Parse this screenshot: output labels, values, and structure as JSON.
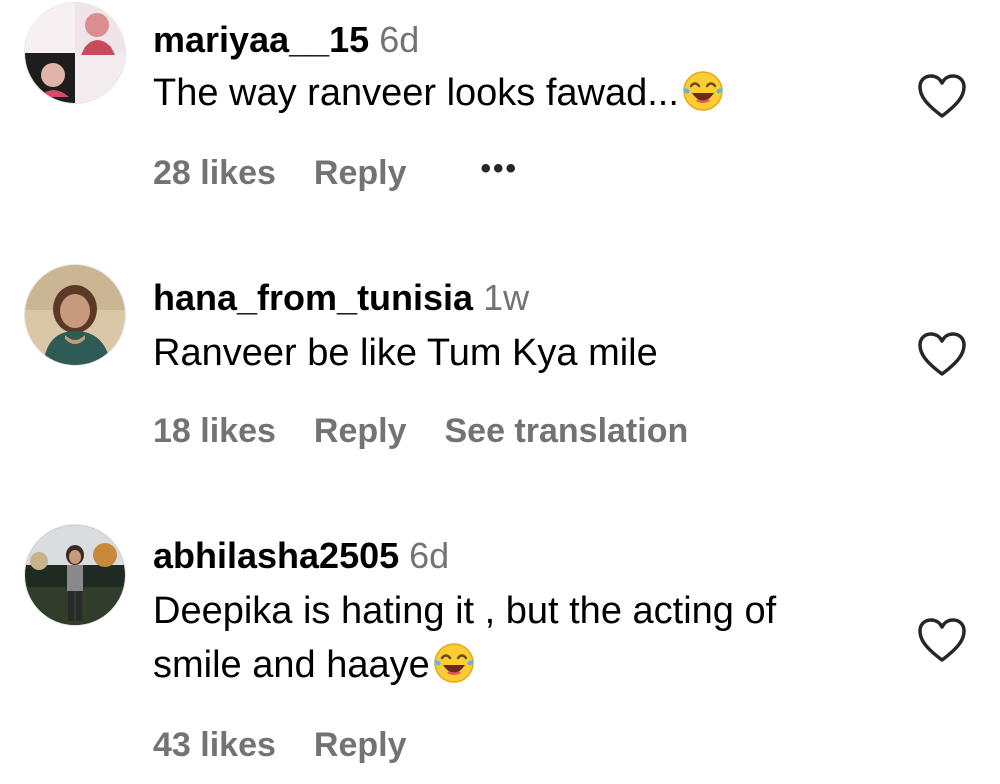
{
  "comments": [
    {
      "username": "mariyaa__15",
      "time": "6d",
      "text": "The way ranveer looks fawad...",
      "emoji": "face-with-tears-of-joy",
      "likes": "28 likes",
      "reply": "Reply",
      "more": "•••"
    },
    {
      "username": "hana_from_tunisia",
      "time": "1w",
      "text": "Ranveer be like Tum Kya mile",
      "likes": "18 likes",
      "reply": "Reply",
      "translate": "See translation"
    },
    {
      "username": "abhilasha2505",
      "time": "6d",
      "text_line1": "Deepika is hating it , but the acting of",
      "text_line2": "smile and haaye",
      "emoji": "face-with-tears-of-joy",
      "likes": "43 likes",
      "reply": "Reply"
    }
  ],
  "colors": {
    "secondary_text": "#737373",
    "primary_text": "#000000",
    "heart_outline": "#262626"
  },
  "icons": {
    "like": "heart-outline-icon",
    "more": "more-options-icon",
    "emoji": "face-with-tears-of-joy"
  }
}
